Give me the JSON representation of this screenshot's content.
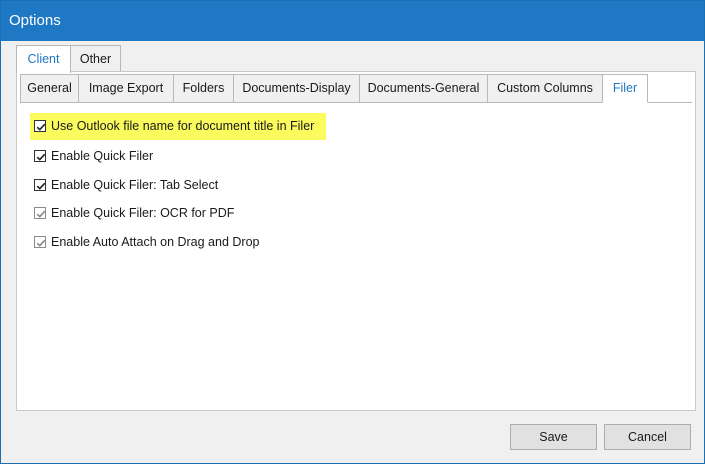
{
  "window": {
    "title": "Options"
  },
  "outer_tabs": [
    {
      "label": "Client",
      "active": true
    },
    {
      "label": "Other",
      "active": false
    }
  ],
  "inner_tabs": [
    {
      "label": "General",
      "active": false
    },
    {
      "label": "Image Export",
      "active": false
    },
    {
      "label": "Folders",
      "active": false
    },
    {
      "label": "Documents-Display",
      "active": false
    },
    {
      "label": "Documents-General",
      "active": false
    },
    {
      "label": "Custom Columns",
      "active": false
    },
    {
      "label": "Filer",
      "active": true
    }
  ],
  "options": [
    {
      "label": "Use Outlook file name for document title in Filer",
      "checked": true,
      "enabled": true,
      "highlighted": true
    },
    {
      "label": "Enable Quick Filer",
      "checked": true,
      "enabled": true
    },
    {
      "label": "Enable Quick Filer: Tab Select",
      "checked": true,
      "enabled": true
    },
    {
      "label": "Enable Quick Filer: OCR for PDF",
      "checked": true,
      "enabled": false
    },
    {
      "label": "Enable Auto Attach on Drag and Drop",
      "checked": true,
      "enabled": false
    }
  ],
  "buttons": {
    "save": "Save",
    "cancel": "Cancel"
  },
  "colors": {
    "titlebar": "#1f78c3",
    "active_tab_text": "#1f78c3",
    "highlight": "#fbfb5e"
  }
}
